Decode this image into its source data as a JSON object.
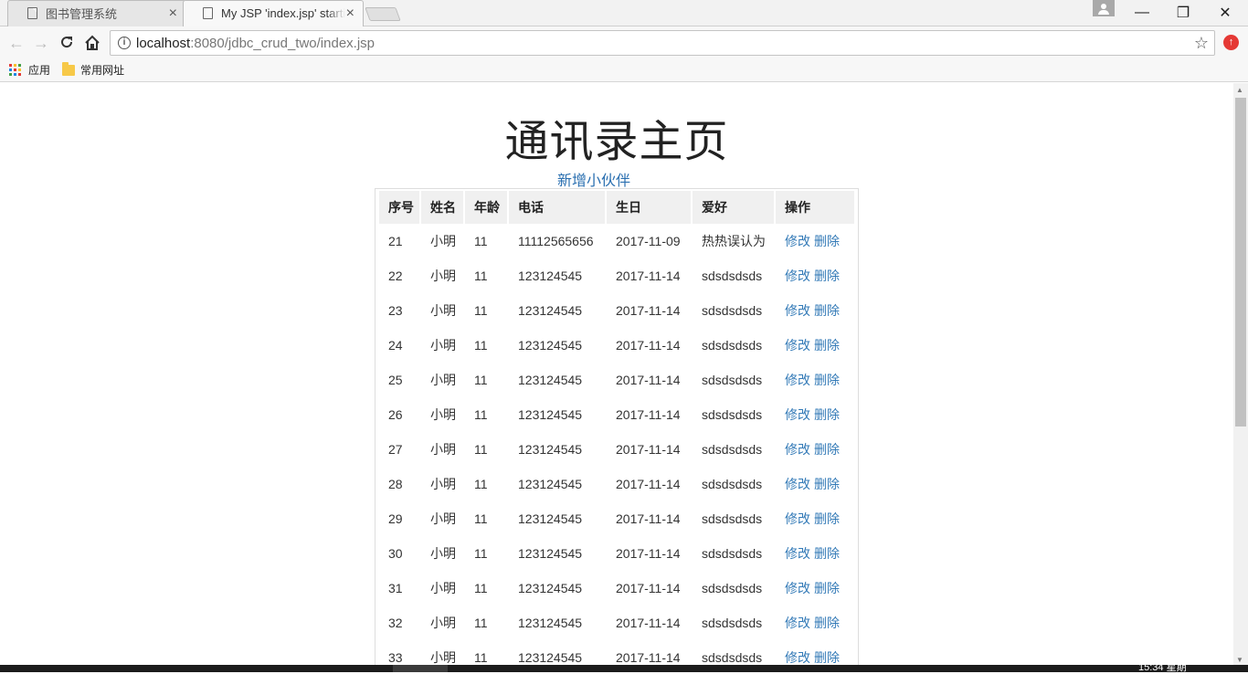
{
  "browser": {
    "tabs": [
      {
        "title": "图书管理系统",
        "active": false
      },
      {
        "title": "My JSP 'index.jsp' starting page",
        "active": true
      }
    ],
    "url_host": "localhost",
    "url_rest": ":8080/jdbc_crud_two/index.jsp",
    "bookmarks": [
      {
        "label": "应用",
        "icon": "apps-grid-icon"
      },
      {
        "label": "常用网址",
        "icon": "folder-icon"
      }
    ],
    "taskbar_clock": "15:34 星期"
  },
  "page": {
    "title": "通讯录主页",
    "add_link": "新增小伙伴",
    "columns": [
      "序号",
      "姓名",
      "年龄",
      "电话",
      "生日",
      "爱好",
      "操作"
    ],
    "edit_label": "修改",
    "delete_label": "删除",
    "rows": [
      {
        "id": "21",
        "name": "小明",
        "age": "11",
        "phone": "11112565656",
        "birthday": "2017-11-09",
        "hobby": "热热误认为"
      },
      {
        "id": "22",
        "name": "小明",
        "age": "11",
        "phone": "123124545",
        "birthday": "2017-11-14",
        "hobby": "sdsdsdsds"
      },
      {
        "id": "23",
        "name": "小明",
        "age": "11",
        "phone": "123124545",
        "birthday": "2017-11-14",
        "hobby": "sdsdsdsds"
      },
      {
        "id": "24",
        "name": "小明",
        "age": "11",
        "phone": "123124545",
        "birthday": "2017-11-14",
        "hobby": "sdsdsdsds"
      },
      {
        "id": "25",
        "name": "小明",
        "age": "11",
        "phone": "123124545",
        "birthday": "2017-11-14",
        "hobby": "sdsdsdsds"
      },
      {
        "id": "26",
        "name": "小明",
        "age": "11",
        "phone": "123124545",
        "birthday": "2017-11-14",
        "hobby": "sdsdsdsds"
      },
      {
        "id": "27",
        "name": "小明",
        "age": "11",
        "phone": "123124545",
        "birthday": "2017-11-14",
        "hobby": "sdsdsdsds"
      },
      {
        "id": "28",
        "name": "小明",
        "age": "11",
        "phone": "123124545",
        "birthday": "2017-11-14",
        "hobby": "sdsdsdsds"
      },
      {
        "id": "29",
        "name": "小明",
        "age": "11",
        "phone": "123124545",
        "birthday": "2017-11-14",
        "hobby": "sdsdsdsds"
      },
      {
        "id": "30",
        "name": "小明",
        "age": "11",
        "phone": "123124545",
        "birthday": "2017-11-14",
        "hobby": "sdsdsdsds"
      },
      {
        "id": "31",
        "name": "小明",
        "age": "11",
        "phone": "123124545",
        "birthday": "2017-11-14",
        "hobby": "sdsdsdsds"
      },
      {
        "id": "32",
        "name": "小明",
        "age": "11",
        "phone": "123124545",
        "birthday": "2017-11-14",
        "hobby": "sdsdsdsds"
      },
      {
        "id": "33",
        "name": "小明",
        "age": "11",
        "phone": "123124545",
        "birthday": "2017-11-14",
        "hobby": "sdsdsdsds"
      }
    ]
  },
  "colors": {
    "link": "#337ab7",
    "header_bg": "#f0f0f0"
  }
}
